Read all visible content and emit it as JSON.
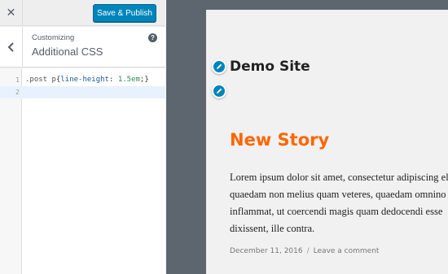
{
  "topbar": {
    "close_icon": "close-icon",
    "publish_label": "Save & Publish"
  },
  "section": {
    "back_icon": "chevron-left-icon",
    "overline": "Customizing",
    "title": "Additional CSS",
    "help_icon": "help-icon"
  },
  "editor": {
    "lines": [
      {
        "number": "1",
        "tokens": {
          "selector": ".post p",
          "open": "{",
          "property": "line-height",
          "colon": ": ",
          "value": "1.5em",
          "close": ";}"
        }
      },
      {
        "number": "2",
        "code": ""
      }
    ]
  },
  "preview": {
    "site_title": "Demo Site",
    "post_title": "New Story",
    "post_body": "Lorem ipsum dolor sit amet, consectetur adipiscing elit, quaedam non melius quam veteres, quaedam omnino inflammat, ut coercendi magis quam dedocendi esse dixissent, ille contra.",
    "post_date": "December 11, 2016",
    "meta_separator": "/",
    "comment_link": "Leave a comment",
    "edit_icon": "pencil-icon"
  },
  "colors": {
    "accent": "#0085ba",
    "post_title": "#ff6600",
    "preview_frame": "#5d666f"
  }
}
